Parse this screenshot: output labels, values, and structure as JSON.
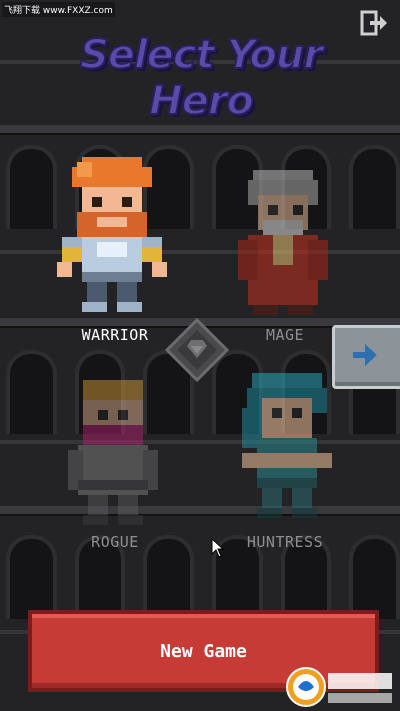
{
  "watermark": "飞翔下载 www.FXXZ.com",
  "title": "Select Your Hero",
  "heroes": [
    {
      "name": "WARRIOR",
      "selected": true
    },
    {
      "name": "MAGE",
      "selected": false
    },
    {
      "name": "ROGUE",
      "selected": false
    },
    {
      "name": "HUNTRESS",
      "selected": false
    }
  ],
  "new_game_label": "New Game",
  "logo": {
    "text": "飞翔下载",
    "url": "WWW.FXXZ.COM"
  },
  "colors": {
    "accent": "#c73b36",
    "title": "#5a4ba8",
    "button_grey": "#8d9499"
  },
  "icons": [
    "exit-icon",
    "next-arrow-icon",
    "challenge-badge-icon",
    "cursor-icon"
  ]
}
